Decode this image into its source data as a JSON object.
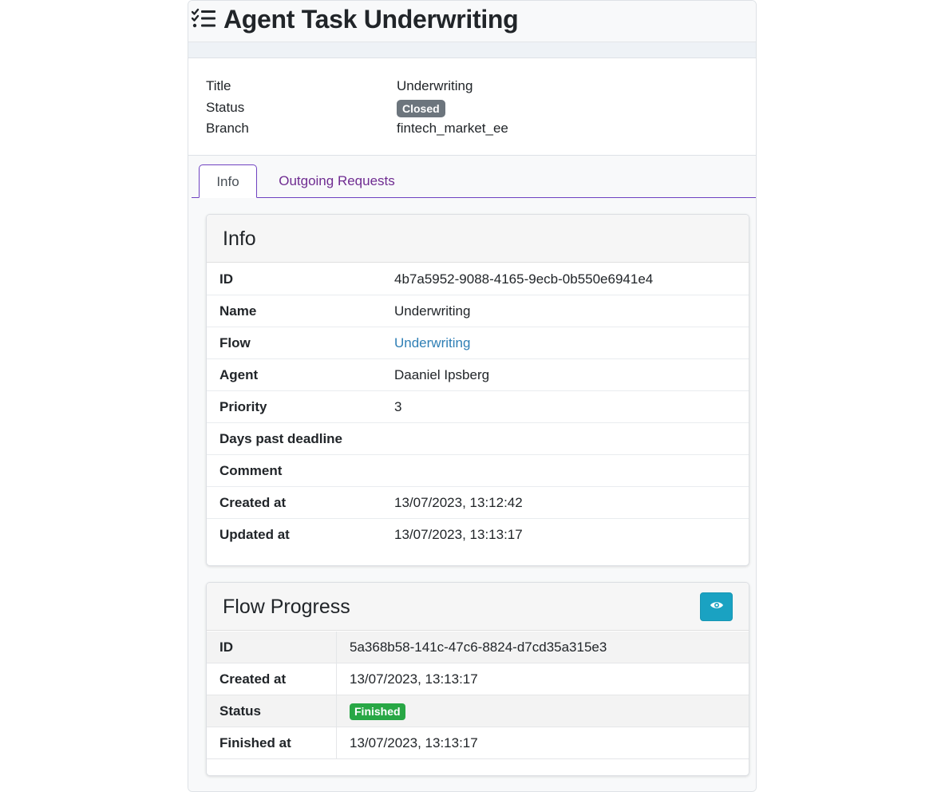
{
  "header": {
    "title": "Agent Task Underwriting",
    "icon": "tasks-list-icon"
  },
  "summary": {
    "title_label": "Title",
    "title_value": "Underwriting",
    "status_label": "Status",
    "status_value": "Closed",
    "branch_label": "Branch",
    "branch_value": "fintech_market_ee"
  },
  "tabs": [
    {
      "label": "Info",
      "active": true
    },
    {
      "label": "Outgoing Requests",
      "active": false
    }
  ],
  "info_card": {
    "title": "Info",
    "rows": [
      {
        "key": "ID",
        "value": "4b7a5952-9088-4165-9ecb-0b550e6941e4"
      },
      {
        "key": "Name",
        "value": "Underwriting"
      },
      {
        "key": "Flow",
        "value": "Underwriting"
      },
      {
        "key": "Agent",
        "value": "Daaniel Ipsberg"
      },
      {
        "key": "Priority",
        "value": "3"
      },
      {
        "key": "Days past deadline",
        "value": ""
      },
      {
        "key": "Comment",
        "value": ""
      },
      {
        "key": "Created at",
        "value": "13/07/2023, 13:12:42"
      },
      {
        "key": "Updated at",
        "value": "13/07/2023, 13:13:17"
      }
    ]
  },
  "flow_progress": {
    "title": "Flow Progress",
    "view_icon": "eye-icon",
    "rows": [
      {
        "key": "ID",
        "value": "5a368b58-141c-47c6-8824-d7cd35a315e3"
      },
      {
        "key": "Created at",
        "value": "13/07/2023, 13:13:17"
      },
      {
        "key": "Status",
        "value": "Finished"
      },
      {
        "key": "Finished at",
        "value": "13/07/2023, 13:13:17"
      }
    ]
  },
  "colors": {
    "tab_accent": "#6f42c1",
    "badge_closed": "#6c757d",
    "badge_finished": "#28a745",
    "view_button": "#1aa2c2",
    "link": "#2f7fb5"
  }
}
